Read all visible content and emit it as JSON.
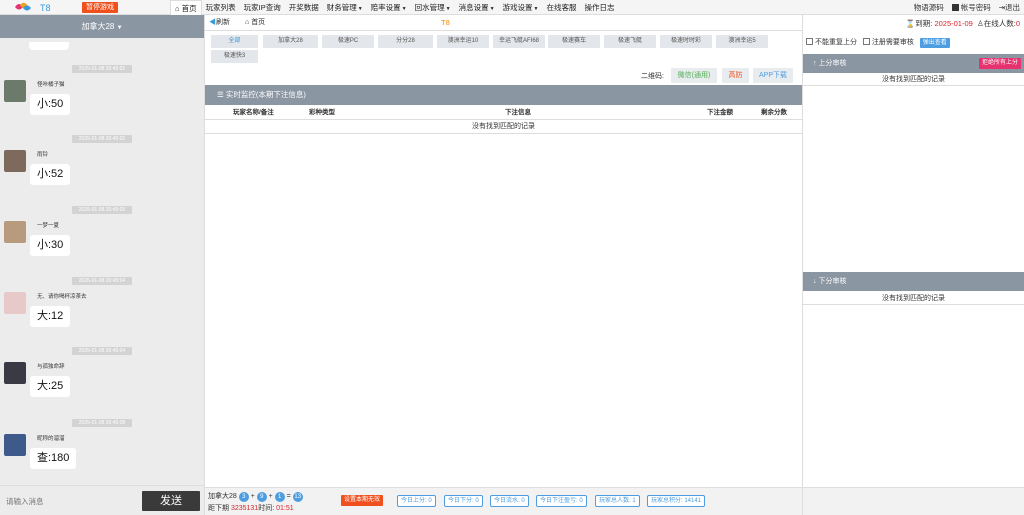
{
  "top": {
    "brand": "T8",
    "pause_label": "暂停游戏",
    "nav": [
      {
        "label": "首页",
        "icon": "home-icon"
      },
      {
        "label": "玩家列表"
      },
      {
        "label": "玩家IP查询"
      },
      {
        "label": "开奖数据"
      },
      {
        "label": "财务管理",
        "dropdown": true
      },
      {
        "label": "赔率设置",
        "dropdown": true
      },
      {
        "label": "回水管理",
        "dropdown": true
      },
      {
        "label": "消息设置",
        "dropdown": true
      },
      {
        "label": "游戏设置",
        "dropdown": true
      },
      {
        "label": "在线客服"
      },
      {
        "label": "操作日志"
      }
    ],
    "right": {
      "qr_code": "物语源码",
      "account_password": "帐号密码",
      "logout": "退出"
    }
  },
  "chat": {
    "room": "加拿大28",
    "messages": [
      {
        "time": "2025-01-08 20:45:01",
        "user": "怪咔橘子猫",
        "text": "小:50",
        "avatar_color": "#6b7a6a"
      },
      {
        "time": "2025-01-08 20:45:02",
        "user": "雨铃",
        "text": "小:52",
        "avatar_color": "#7d6a5c"
      },
      {
        "time": "2025-01-08 20:45:03",
        "user": "一梦一夏",
        "text": "小:30",
        "avatar_color": "#b89a7c"
      },
      {
        "time": "2025-01-08 20:45:04",
        "user": "无、请你喝杯凉茶去",
        "text": "大:12",
        "avatar_color": "#e8c9c9"
      },
      {
        "time": "2025-01-08 20:45:04",
        "user": "与孤独命辞",
        "text": "大:25",
        "avatar_color": "#3a3a45"
      },
      {
        "time": "2025-01-08 20:45:08",
        "user": "昵称的溜溜",
        "text": "查:180",
        "avatar_color": "#3d5a8a"
      }
    ],
    "input_placeholder": "请输入消息",
    "send_label": "发送"
  },
  "main": {
    "tabs": {
      "refresh": "刷新",
      "home": "首页",
      "title": "T8"
    },
    "filters": [
      "全部",
      "加拿大28",
      "极速PC",
      "分分28",
      "澳洲幸运10",
      "幸运飞艇AFI68",
      "极速赛车",
      "极速飞艇",
      "极速时时彩",
      "澳洲幸运5",
      "极速快3"
    ],
    "qr_label": "二维码:",
    "qr_buttons": [
      {
        "label": "微信(通用)",
        "color": "#4caf50"
      },
      {
        "label": "高防",
        "color": "#f0501e"
      },
      {
        "label": "APP下载",
        "color": "#4d9de0"
      }
    ],
    "monitor_title": "实时监控(本期下注信息)",
    "columns": [
      "玩家名称/备注",
      "彩种类型",
      "下注信息",
      "下注金额",
      "剩余分数"
    ],
    "empty_text": "没有找到匹配的记录"
  },
  "bottom": {
    "game": "加拿大28",
    "balls": [
      "3",
      "9",
      "1",
      "13"
    ],
    "next_label": "距下期",
    "issue": "3235131",
    "time_label": "时间:",
    "countdown": "01:51",
    "cancel_label": "设置本期无效",
    "stats": [
      "今日上分: 0",
      "今日下分: 0",
      "今日流水: 0",
      "今日下注盈亏: 0",
      "玩家总人数: 1",
      "玩家总积分: 14141"
    ]
  },
  "right": {
    "header": {
      "expiry_label": "到期:",
      "expiry_date": "2025-01-09",
      "online_label": "在线人数:",
      "online_count": "0"
    },
    "options": {
      "no_repeat": "不能重复上分",
      "register_review": "注册需要审核",
      "popup": "弹出查看"
    },
    "up_title": "上分审核",
    "reject_all": "拒绝所有上分",
    "down_title": "下分审核",
    "empty_text": "没有找到匹配的记录"
  }
}
